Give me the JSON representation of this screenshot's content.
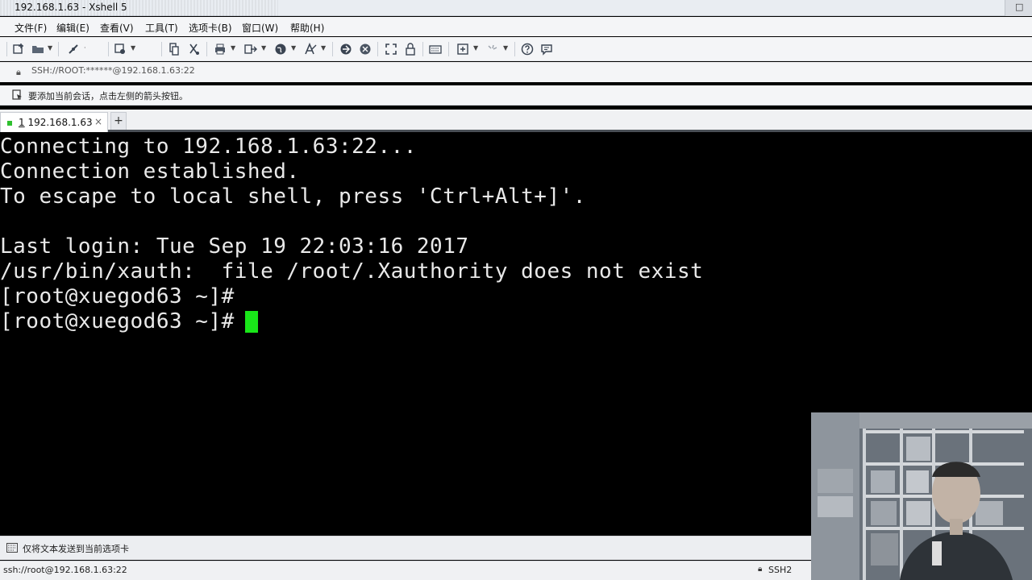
{
  "window": {
    "title": "192.168.1.63 - Xshell 5",
    "control": "□"
  },
  "menu": [
    "文件(F)",
    "编辑(E)",
    "查看(V)",
    "工具(T)",
    "选项卡(B)",
    "窗口(W)",
    "帮助(H)"
  ],
  "toolbar": {
    "icons": [
      "new-session-icon",
      "open-folder-icon",
      "reconnect-icon",
      "disconnect-icon",
      "properties-icon",
      "copy-icon",
      "paste-icon",
      "print-icon",
      "transfer-icon",
      "globe-icon",
      "font-icon",
      "xftp-icon",
      "xmanager-icon",
      "fullscreen-icon",
      "lock-icon",
      "keyboard-icon",
      "compose-icon",
      "highlight-icon",
      "help-icon",
      "chat-icon"
    ]
  },
  "address": {
    "value": "SSH://ROOT:******@192.168.1.63:22"
  },
  "hint": {
    "text": "要添加当前会话，点击左侧的箭头按钮。"
  },
  "tabs": [
    {
      "number": "1",
      "label": " 192.168.1.63",
      "close": "×"
    }
  ],
  "add_tab": "+",
  "terminal": {
    "lines": [
      "Connecting to 192.168.1.63:22...",
      "Connection established.",
      "To escape to local shell, press 'Ctrl+Alt+]'.",
      "",
      "Last login: Tue Sep 19 22:03:16 2017",
      "/usr/bin/xauth:  file /root/.Xauthority does not exist",
      "[root@xuegod63 ~]#",
      "[root@xuegod63 ~]# "
    ],
    "cursor_color": "#19e619"
  },
  "send_bar": {
    "text": "仅将文本发送到当前选项卡"
  },
  "status": {
    "connection": "ssh://root@192.168.1.63:22",
    "protocol": "SSH2"
  }
}
